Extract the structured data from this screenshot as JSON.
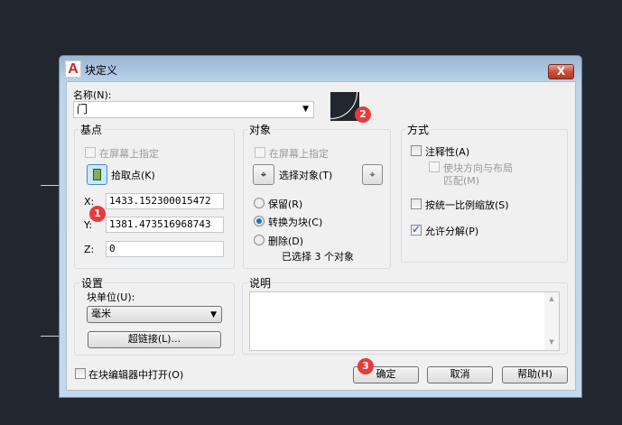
{
  "window": {
    "title": "块定义",
    "close_label": "X"
  },
  "name": {
    "label": "名称(N):",
    "value": "门"
  },
  "basepoint": {
    "title": "基点",
    "specify_on_screen": "在屏幕上指定",
    "pick_point": "拾取点(K)",
    "x_label": "X:",
    "x_value": "1433.152300015472",
    "y_label": "Y:",
    "y_value": "1381.473516968743",
    "z_label": "Z:",
    "z_value": "0"
  },
  "objects": {
    "title": "对象",
    "specify_on_screen": "在屏幕上指定",
    "select_objects": "选择对象(T)",
    "retain": "保留(R)",
    "convert": "转换为块(C)",
    "delete": "删除(D)",
    "selected_count": "已选择 3 个对象",
    "selected_radio": "convert"
  },
  "behavior": {
    "title": "方式",
    "annotative": "注释性(A)",
    "match_orientation_1": "使块方向与布局",
    "match_orientation_2": "匹配(M)",
    "scale_uniformly": "按统一比例缩放(S)",
    "allow_exploding": "允许分解(P)",
    "allow_exploding_checked": true
  },
  "settings": {
    "title": "设置",
    "block_unit_label": "块单位(U):",
    "block_unit_value": "毫米",
    "hyperlink": "超链接(L)..."
  },
  "description": {
    "title": "说明",
    "value": ""
  },
  "open_in_editor": "在块编辑器中打开(O)",
  "buttons": {
    "ok": "确定",
    "cancel": "取消",
    "help": "帮助(H)"
  },
  "annotations": {
    "one": "1",
    "two": "2",
    "three": "3"
  },
  "colors": {
    "badge": "#ea3a3a",
    "background": "#22272f"
  }
}
